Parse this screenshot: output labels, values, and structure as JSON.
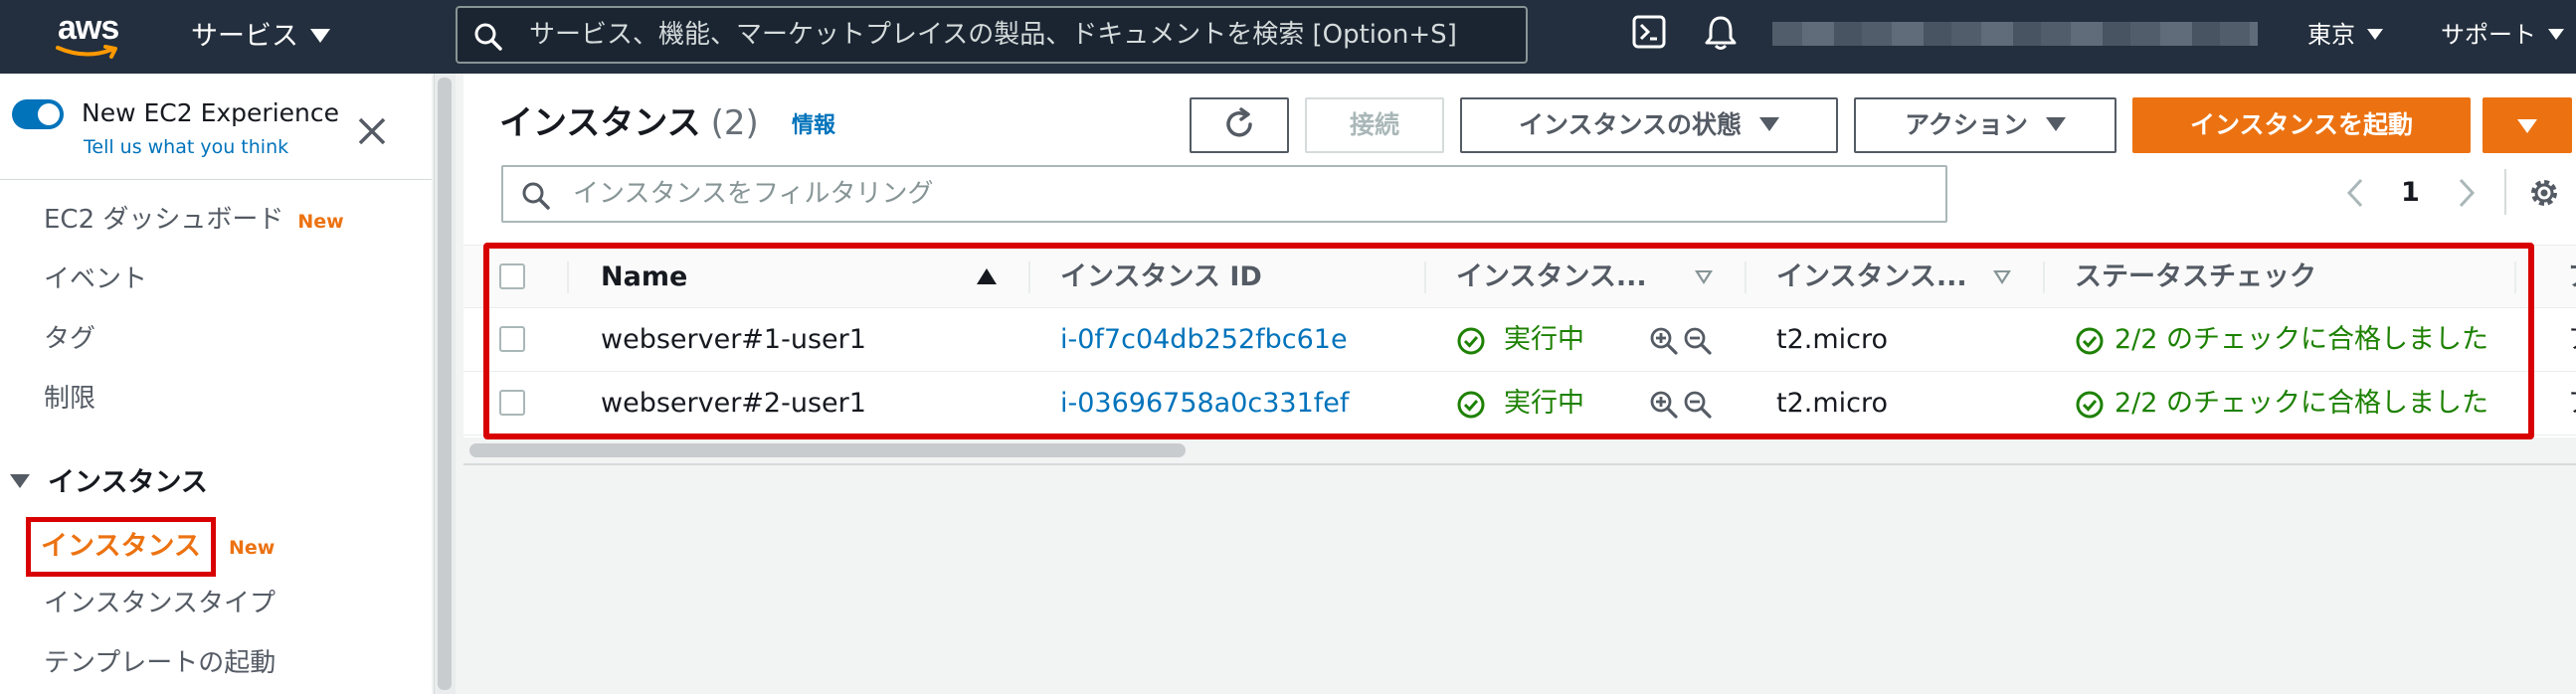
{
  "topnav": {
    "logo_text": "aws",
    "services_label": "サービス",
    "search_placeholder": "サービス、機能、マーケットプレイスの製品、ドキュメントを検索 [Option+S]",
    "region_label": "東京",
    "support_label": "サポート"
  },
  "sidebar": {
    "experience_title": "New EC2 Experience",
    "experience_link": "Tell us what you think",
    "items": [
      {
        "label": "EC2 ダッシュボード",
        "badge": "New"
      },
      {
        "label": "イベント"
      },
      {
        "label": "タグ"
      },
      {
        "label": "制限"
      }
    ],
    "section_label": "インスタンス",
    "active_item": {
      "label": "インスタンス",
      "badge": "New"
    },
    "sub_items": [
      {
        "label": "インスタンスタイプ"
      },
      {
        "label": "テンプレートの起動"
      }
    ]
  },
  "main": {
    "title": "インスタンス",
    "count": "(2)",
    "info_link": "情報",
    "buttons": {
      "connect": "接続",
      "instance_state": "インスタンスの状態",
      "actions": "アクション",
      "launch": "インスタンスを起動"
    },
    "filter_placeholder": "インスタンスをフィルタリング",
    "page_number": "1",
    "table": {
      "columns": [
        "Name",
        "インスタンス ID",
        "インスタンス...",
        "インスタンス...",
        "ステータスチェック",
        "ア"
      ],
      "rows": [
        {
          "name": "webserver#1-user1",
          "instance_id": "i-0f7c04db252fbc61e",
          "state": "実行中",
          "type": "t2.micro",
          "status_check": "2/2 のチェックに合格しました",
          "extra": "ア"
        },
        {
          "name": "webserver#2-user1",
          "instance_id": "i-03696758a0c331fef",
          "state": "実行中",
          "type": "t2.micro",
          "status_check": "2/2 のチェックに合格しました",
          "extra": "ア"
        }
      ]
    }
  },
  "colors": {
    "nav_bg": "#232f3e",
    "accent_orange": "#ec7211",
    "link_blue": "#0073bb",
    "success_green": "#1d8102",
    "highlight_red": "#d80000"
  }
}
